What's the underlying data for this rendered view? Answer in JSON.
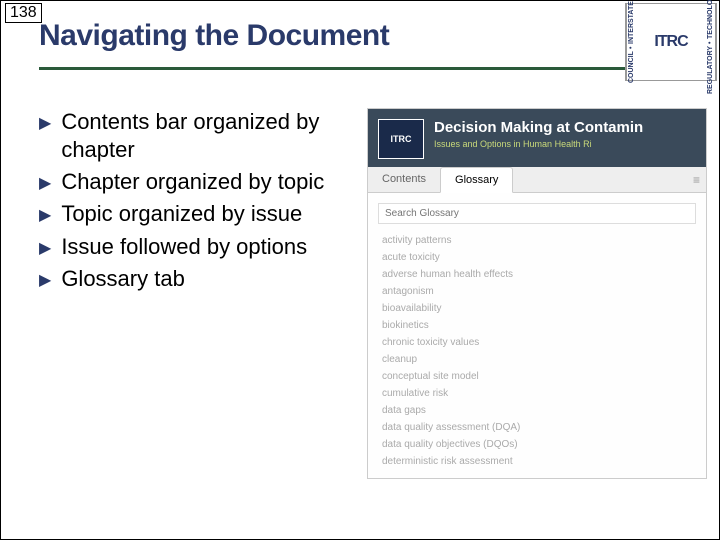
{
  "page_number": "138",
  "title": "Navigating the Document",
  "logo": {
    "left_top": "INTERSTATE",
    "left_bottom": "COUNCIL",
    "center": "ITRC",
    "right_top": "TECHNOLOGY",
    "right_bottom": "REGULATORY"
  },
  "bullets": [
    "Contents bar organized by chapter",
    "Chapter organized by topic",
    "Topic organized by issue",
    "Issue followed by options",
    "Glossary tab"
  ],
  "screenshot": {
    "logo": "ITRC",
    "title": "Decision Making at Contamin",
    "subtitle": "Issues and Options in Human Health Ri",
    "tabs": {
      "contents": "Contents",
      "glossary": "Glossary"
    },
    "search_placeholder": "Search Glossary",
    "glossary_items": [
      "activity patterns",
      "acute toxicity",
      "adverse human health effects",
      "antagonism",
      "bioavailability",
      "biokinetics",
      "chronic toxicity values",
      "cleanup",
      "conceptual site model",
      "cumulative risk",
      "data gaps",
      "data quality assessment (DQA)",
      "data quality objectives (DQOs)",
      "deterministic risk assessment"
    ]
  }
}
